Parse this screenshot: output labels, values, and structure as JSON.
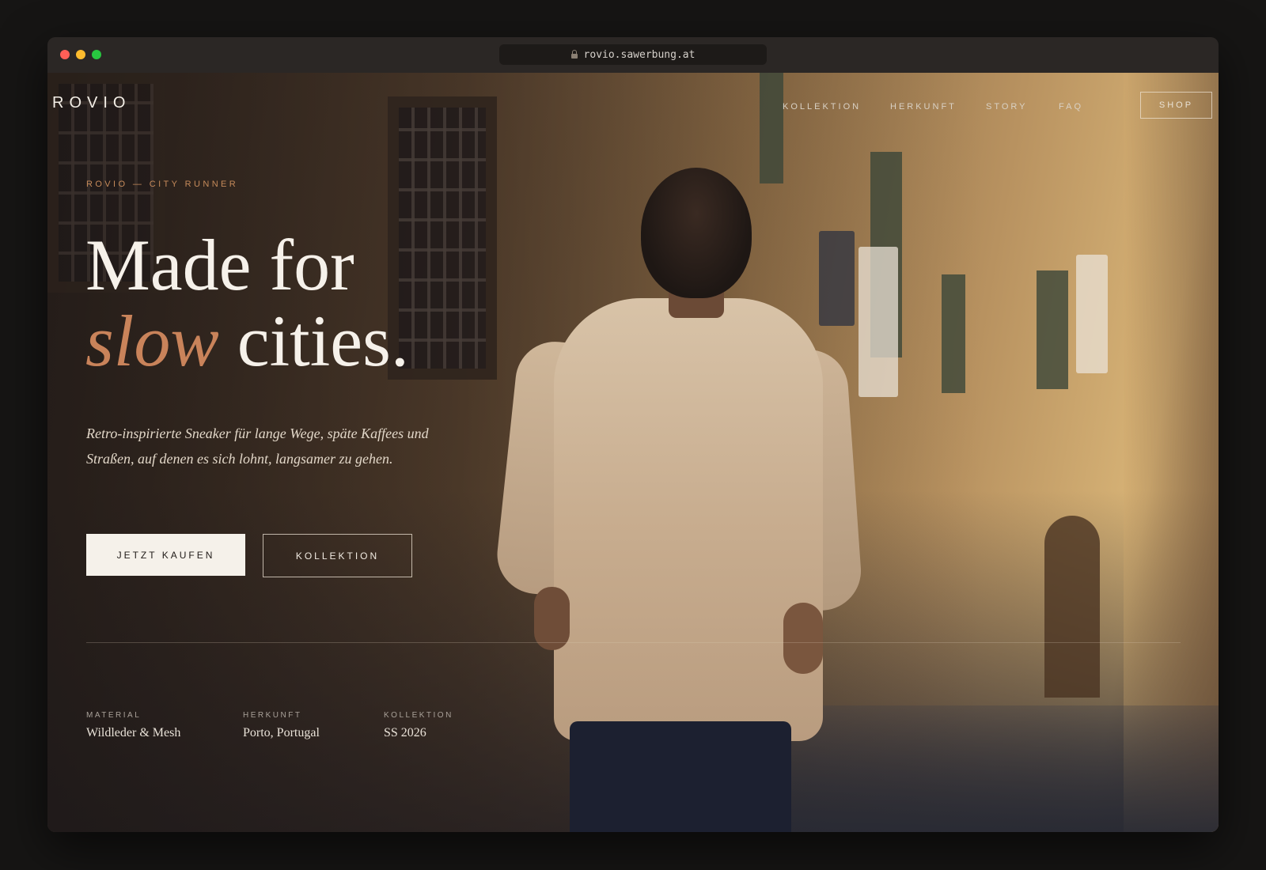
{
  "browser": {
    "url": "rovio.sawerbung.at"
  },
  "site": {
    "logo": "ROVIO",
    "nav": [
      "KOLLEKTION",
      "HERKUNFT",
      "STORY",
      "FAQ"
    ],
    "shop_label": "SHOP"
  },
  "hero": {
    "eyebrow": "ROVIO — CITY RUNNER",
    "headline_line1": "Made for",
    "headline_accent": "slow",
    "headline_line2_rest": " cities.",
    "subtitle": "Retro-inspirierte Sneaker für lange Wege, späte Kaffees und Straßen, auf denen es sich lohnt, langsamer zu gehen.",
    "primary_cta": "JETZT KAUFEN",
    "secondary_cta": "KOLLEKTION"
  },
  "meta": [
    {
      "label": "MATERIAL",
      "value": "Wildleder & Mesh"
    },
    {
      "label": "HERKUNFT",
      "value": "Porto, Portugal"
    },
    {
      "label": "KOLLEKTION",
      "value": "SS 2026"
    }
  ],
  "colors": {
    "accent": "#c9835a",
    "eyebrow": "#c58a5a",
    "primary_button_bg": "#f5f1ea"
  }
}
